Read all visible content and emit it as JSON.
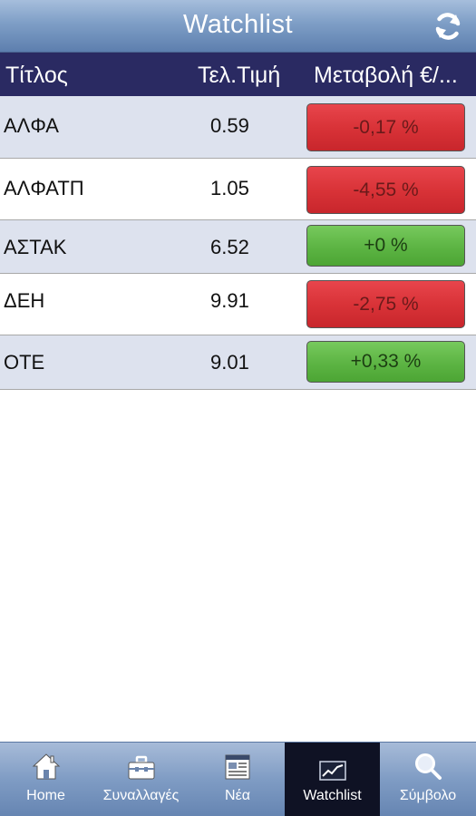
{
  "header": {
    "title": "Watchlist",
    "refresh_icon": "refresh-icon"
  },
  "columns": {
    "name": "Τίτλος",
    "price": "Τελ.Τιμή",
    "change": "Μεταβολή €/..."
  },
  "rows": [
    {
      "symbol": "ΑΛΦΑ",
      "price": "0.59",
      "change": "-0,17 %",
      "status": "negative"
    },
    {
      "symbol": "ΑΛΦΑΤΠ",
      "price": "1.05",
      "change": "-4,55 %",
      "status": "negative"
    },
    {
      "symbol": "ΑΣΤΑΚ",
      "price": "6.52",
      "change": "+0 %",
      "status": "positive"
    },
    {
      "symbol": "ΔΕΗ",
      "price": "9.91",
      "change": "-2,75 %",
      "status": "negative"
    },
    {
      "symbol": "ΟΤΕ",
      "price": "9.01",
      "change": "+0,33 %",
      "status": "positive"
    }
  ],
  "nav": [
    {
      "label": "Home",
      "icon": "home-icon"
    },
    {
      "label": "Συναλλαγές",
      "icon": "briefcase-icon"
    },
    {
      "label": "Νέα",
      "icon": "newspaper-icon"
    },
    {
      "label": "Watchlist",
      "icon": "chart-line-icon",
      "active": true
    },
    {
      "label": "Σύμβολο",
      "icon": "search-icon"
    }
  ],
  "colors": {
    "title_bar": "#7e9ec6",
    "column_header": "#2a2a62",
    "row_shade": "#dde2ee",
    "negative": "#d93338",
    "positive": "#5cb443",
    "nav_active": "#0f1224"
  }
}
